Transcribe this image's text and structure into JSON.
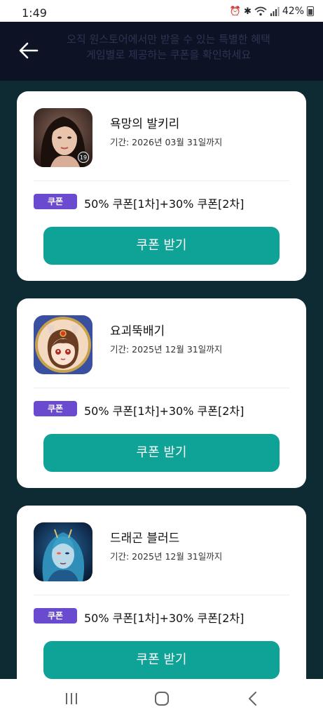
{
  "status_bar": {
    "time": "1:49",
    "battery": "42%",
    "icons": [
      "alarm-icon",
      "bluetooth-icon",
      "wifi-icon",
      "signal-icon",
      "battery-icon"
    ]
  },
  "header": {
    "back_icon": "arrow-left-icon",
    "subtitle_line1": "오직 원스토어에서만 받을 수 있는 특별한 혜택",
    "subtitle_line2": "게임별로 제공하는 쿠폰을 확인하세요"
  },
  "cards": [
    {
      "title": "욕망의 발키리",
      "period": "기간: 2026년 03월 31일까지",
      "badge": "쿠폰",
      "coupon": "50% 쿠폰[1차]+30% 쿠폰[2차]",
      "button": "쿠폰 받기",
      "age_rating": "19"
    },
    {
      "title": "요괴뚝배기",
      "period": "기간: 2025년 12월 31일까지",
      "badge": "쿠폰",
      "coupon": "50% 쿠폰[1차]+30% 쿠폰[2차]",
      "button": "쿠폰 받기"
    },
    {
      "title": "드래곤 블러드",
      "period": "기간: 2025년 12월 31일까지",
      "badge": "쿠폰",
      "coupon": "50% 쿠폰[1차]+30% 쿠폰[2차]",
      "button": "쿠폰 받기"
    }
  ],
  "colors": {
    "header_bg": "#0d1225",
    "content_bg": "#0e2a32",
    "button": "#0fa297",
    "badge": "#6a4bd0"
  },
  "nav_bar": {
    "icons": [
      "recent-apps-icon",
      "home-icon",
      "back-icon"
    ]
  }
}
